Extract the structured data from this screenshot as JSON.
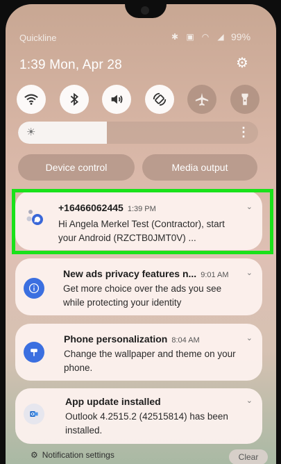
{
  "status_bar": {
    "carrier": "Quickline",
    "battery": "99%"
  },
  "header": {
    "datetime": "1:39  Mon, Apr 28"
  },
  "quick_buttons": {
    "device_control": "Device control",
    "media_output": "Media output"
  },
  "brightness": {
    "level": 0.37
  },
  "notifications": [
    {
      "title": "+16466062445",
      "time": "1:39 PM",
      "body": "Hi Angela Merkel Test (Contractor), start your Android (RZCTB0JMT0V) ...",
      "icon": "messages-icon",
      "highlighted": true
    },
    {
      "title": "New ads privacy features n...",
      "time": "9:01 AM",
      "body": "Get more choice over the ads you see while protecting your identity",
      "icon": "info-icon"
    },
    {
      "title": "Phone personalization",
      "time": "8:04 AM",
      "body": "Change the wallpaper and theme on your phone.",
      "icon": "personalization-icon"
    },
    {
      "title": "App update installed",
      "time": "",
      "body": "Outlook 4.2515.2 (42515814) has been installed.",
      "icon": "outlook-icon"
    }
  ],
  "footer": {
    "notification_settings": "Notification settings",
    "clear": "Clear"
  },
  "colors": {
    "highlight": "#1ae21a",
    "info_blue": "#3b6fe0"
  }
}
